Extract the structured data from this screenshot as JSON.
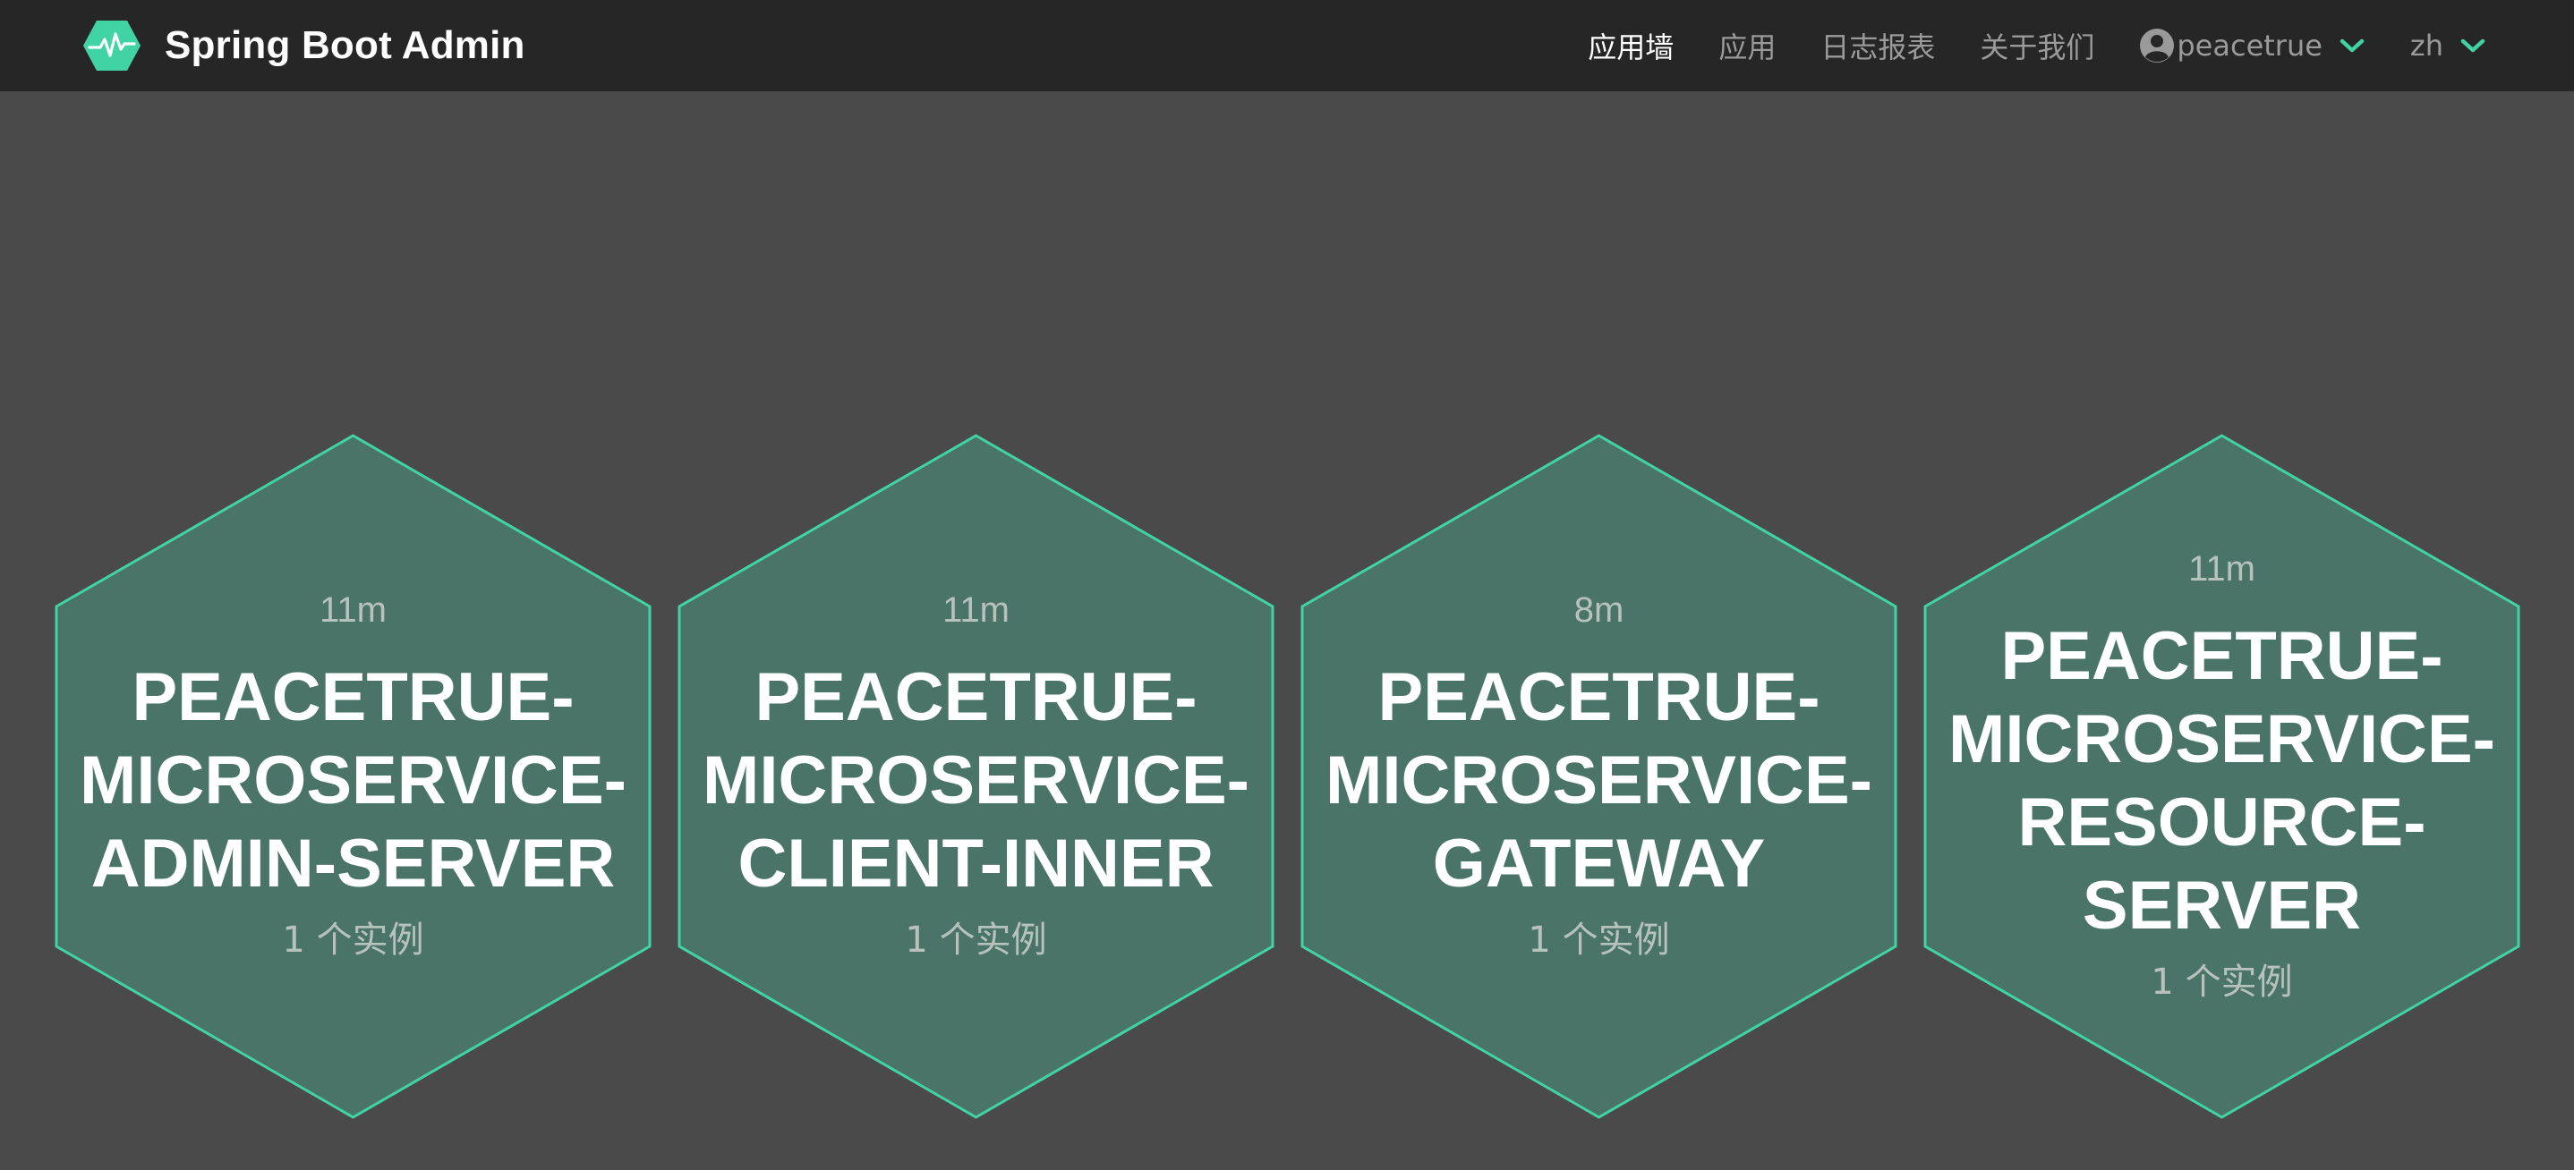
{
  "brand": {
    "title": "Spring Boot Admin",
    "logo_icon": "heartbeat-hexagon-icon",
    "accent_color": "#42d3a5"
  },
  "nav": {
    "items": [
      {
        "label": "应用墙",
        "active": true
      },
      {
        "label": "应用",
        "active": false
      },
      {
        "label": "日志报表",
        "active": false
      },
      {
        "label": "关于我们",
        "active": false
      }
    ],
    "user": {
      "name": "peacetrue",
      "icon": "user-circle-icon",
      "dropdown_icon": "chevron-down-icon"
    },
    "language": {
      "value": "zh",
      "dropdown_icon": "chevron-down-icon"
    }
  },
  "applications": [
    {
      "uptime": "11m",
      "name": "PEACETRUE-MICROSERVICE-ADMIN-SERVER",
      "instances": "1 个实例",
      "status_color": "#42d3a5"
    },
    {
      "uptime": "11m",
      "name": "PEACETRUE-MICROSERVICE-CLIENT-INNER",
      "instances": "1 个实例",
      "status_color": "#42d3a5"
    },
    {
      "uptime": "8m",
      "name": "PEACETRUE-MICROSERVICE-GATEWAY",
      "instances": "1 个实例",
      "status_color": "#42d3a5"
    },
    {
      "uptime": "11m",
      "name": "PEACETRUE-MICROSERVICE-RESOURCE-SERVER",
      "instances": "1 个实例",
      "status_color": "#42d3a5"
    }
  ]
}
